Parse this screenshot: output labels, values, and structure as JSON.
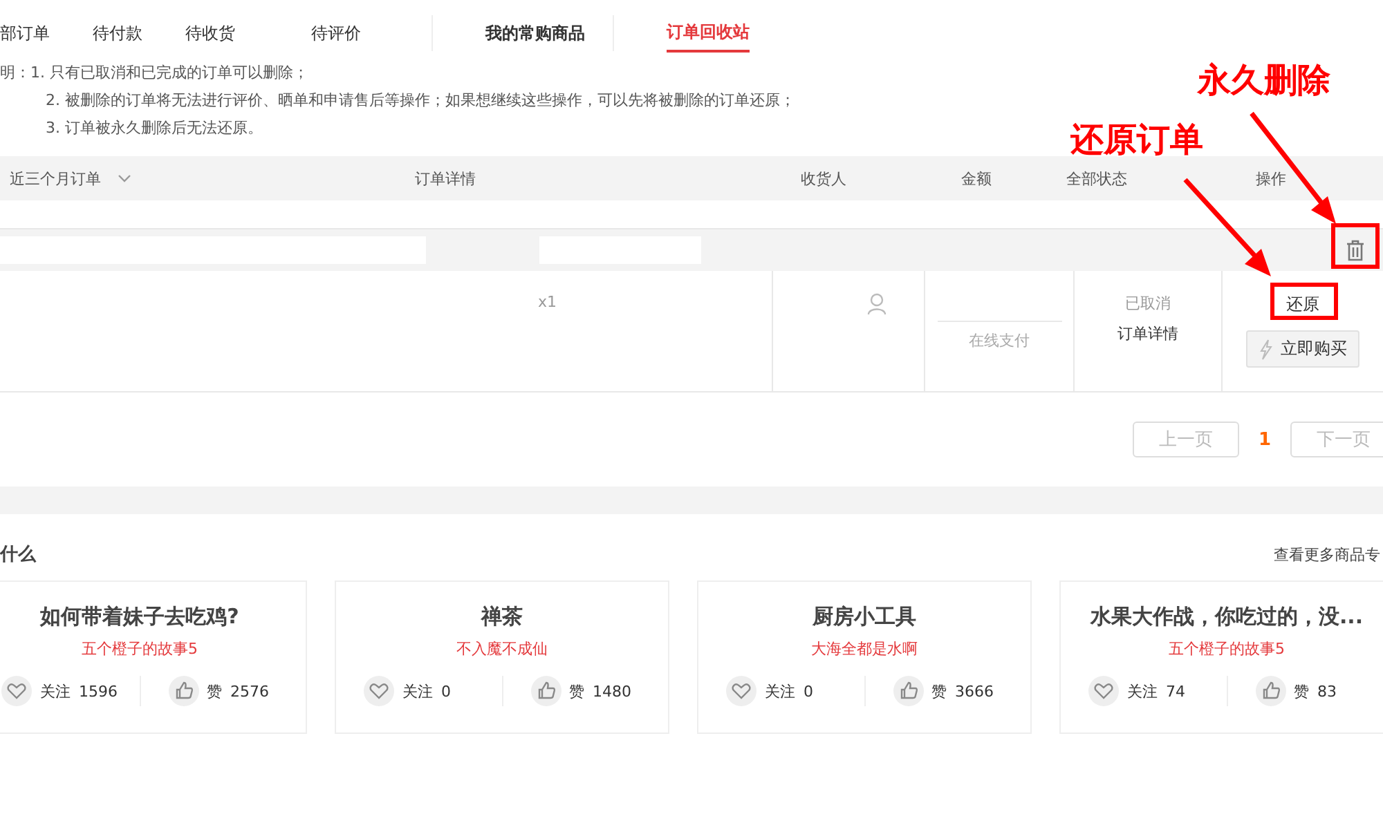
{
  "tabs": [
    {
      "label": "部订单",
      "kind": "plain",
      "selected": false
    },
    {
      "label": "待付款",
      "kind": "plain",
      "selected": false
    },
    {
      "label": "待收货",
      "kind": "plain",
      "selected": false
    },
    {
      "label": "待评价",
      "kind": "plain",
      "selected": false
    },
    {
      "label": "我的常购商品",
      "kind": "strong",
      "selected": false
    },
    {
      "label": "订单回收站",
      "kind": "strong",
      "selected": true
    }
  ],
  "notice": {
    "label": "明：",
    "lines": [
      "1. 只有已取消和已完成的订单可以删除；",
      "2. 被删除的订单将无法进行评价、晒单和申请售后等操作；如果想继续这些操作，可以先将被删除的订单还原；",
      "3. 订单被永久删除后无法还原。"
    ]
  },
  "table": {
    "period_filter": "近三个月订单",
    "columns": [
      "订单详情",
      "收货人",
      "金额",
      "全部状态",
      "操作"
    ],
    "rows": [
      {
        "quantity": "x1",
        "payment": "在线支付",
        "status": "已取消",
        "detail_link": "订单详情",
        "restore_button": "还原",
        "buy_button": "立即购买"
      }
    ]
  },
  "pagination": {
    "prev": "上一页",
    "pages": [
      {
        "label": "1",
        "selected": true
      }
    ],
    "next": "下一页"
  },
  "recommend": {
    "title": "什么",
    "more_link": "查看更多商品专",
    "cards": [
      {
        "title": "如何带着妹子去吃鸡?",
        "author": "五个橙子的故事5",
        "follow_label": "关注",
        "follows": "1596",
        "like_label": "赞",
        "likes": "2576"
      },
      {
        "title": "禅茶",
        "author": "不入魔不成仙",
        "follow_label": "关注",
        "follows": "0",
        "like_label": "赞",
        "likes": "1480"
      },
      {
        "title": "厨房小工具",
        "author": "大海全都是水啊",
        "follow_label": "关注",
        "follows": "0",
        "like_label": "赞",
        "likes": "3666"
      },
      {
        "title": "水果大作战，你吃过的，没...",
        "author": "五个橙子的故事5",
        "follow_label": "关注",
        "follows": "74",
        "like_label": "赞",
        "likes": "83"
      }
    ]
  },
  "annotations": [
    {
      "label": "永久删除"
    },
    {
      "label": "还原订单"
    }
  ]
}
